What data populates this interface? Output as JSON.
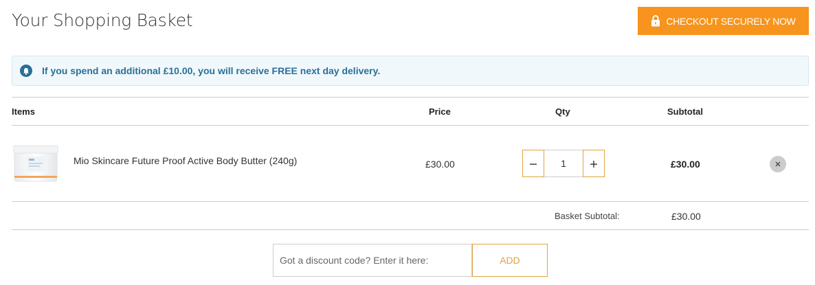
{
  "header": {
    "title": "Your Shopping Basket",
    "checkout_label": "CHECKOUT SECURELY NOW",
    "checkout_icon": "lock-icon",
    "accent_color": "#f7941d"
  },
  "notice": {
    "icon": "info-icon",
    "text": "If you spend an additional £10.00, you will receive FREE next day delivery."
  },
  "table": {
    "headers": {
      "items": "Items",
      "price": "Price",
      "qty": "Qty",
      "subtotal": "Subtotal"
    },
    "rows": [
      {
        "name": "Mio Skincare Future Proof Active Body Butter (240g)",
        "price": "£30.00",
        "qty": "1",
        "subtotal": "£30.00",
        "decrement_icon": "minus-icon",
        "increment_icon": "plus-icon",
        "remove_icon": "close-icon"
      }
    ],
    "basket_subtotal_label": "Basket Subtotal:",
    "basket_subtotal_value": "£30.00"
  },
  "discount": {
    "placeholder": "Got a discount code? Enter it here:",
    "value": "",
    "add_label": "ADD"
  }
}
